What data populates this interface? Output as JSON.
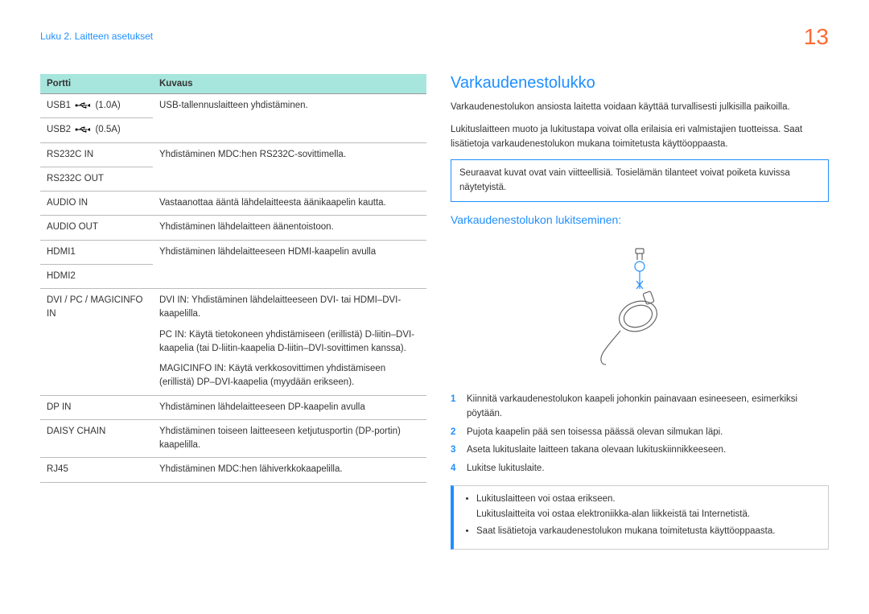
{
  "breadcrumb": "Luku 2. Laitteen asetukset",
  "page_number": "13",
  "table": {
    "header_port": "Portti",
    "header_desc": "Kuvaus",
    "rows": [
      {
        "port": "USB1",
        "amp": "(1.0A)",
        "desc": [
          "USB-tallennuslaitteen yhdistäminen."
        ]
      },
      {
        "port": "USB2",
        "amp": "(0.5A)",
        "desc": []
      },
      {
        "port": "RS232C IN",
        "desc": [
          "Yhdistäminen MDC:hen RS232C-sovittimella."
        ]
      },
      {
        "port": "RS232C OUT",
        "desc": []
      },
      {
        "port": "AUDIO IN",
        "desc": [
          "Vastaanottaa ääntä lähdelaitteesta äänikaapelin kautta."
        ]
      },
      {
        "port": "AUDIO OUT",
        "desc": [
          "Yhdistäminen lähdelaitteen äänentoistoon."
        ]
      },
      {
        "port": "HDMI1",
        "desc": [
          "Yhdistäminen lähdelaitteeseen HDMI-kaapelin avulla"
        ]
      },
      {
        "port": "HDMI2",
        "desc": []
      },
      {
        "port": "DVI / PC / MAGICINFO IN",
        "desc": [
          "DVI IN: Yhdistäminen lähdelaitteeseen DVI- tai HDMI–DVI-kaapelilla.",
          "PC IN: Käytä tietokoneen yhdistämiseen (erillistä) D-liitin–DVI-kaapelia (tai D-liitin-kaapelia D-liitin–DVI-sovittimen kanssa).",
          "MAGICINFO IN: Käytä verkkosovittimen yhdistämiseen (erillistä) DP–DVI-kaapelia (myydään erikseen)."
        ]
      },
      {
        "port": "DP IN",
        "desc": [
          "Yhdistäminen lähdelaitteeseen DP-kaapelin avulla"
        ]
      },
      {
        "port": "DAISY CHAIN",
        "desc": [
          "Yhdistäminen toiseen laitteeseen ketjutusportin (DP-portin) kaapelilla."
        ]
      },
      {
        "port": "RJ45",
        "desc": [
          "Yhdistäminen MDC:hen lähiverkkokaapelilla."
        ]
      }
    ]
  },
  "right": {
    "heading": "Varkaudenestolukko",
    "p1": "Varkaudenestolukon ansiosta laitetta voidaan käyttää turvallisesti julkisilla paikoilla.",
    "p2": "Lukituslaitteen muoto ja lukitustapa voivat olla erilaisia eri valmistajien tuotteissa. Saat lisätietoja varkaudenestolukon mukana toimitetusta käyttöoppaasta.",
    "note": "Seuraavat kuvat ovat vain viitteellisiä. Tosielämän tilanteet voivat poiketa kuvissa näytetyistä.",
    "sub_heading": "Varkaudenestolukon lukitseminen:",
    "steps": [
      "Kiinnitä varkaudenestolukon kaapeli johonkin painavaan esineeseen, esimerkiksi pöytään.",
      "Pujota kaapelin pää sen toisessa päässä olevan silmukan läpi.",
      "Aseta lukituslaite laitteen takana olevaan lukituskiinnikkeeseen.",
      "Lukitse lukituslaite."
    ],
    "info": [
      "Lukituslaitteen voi ostaa erikseen.",
      "Lukituslaitteita voi ostaa elektroniikka-alan liikkeistä tai Internetistä.",
      "Saat lisätietoja varkaudenestolukon mukana toimitetusta käyttöoppaasta."
    ]
  }
}
